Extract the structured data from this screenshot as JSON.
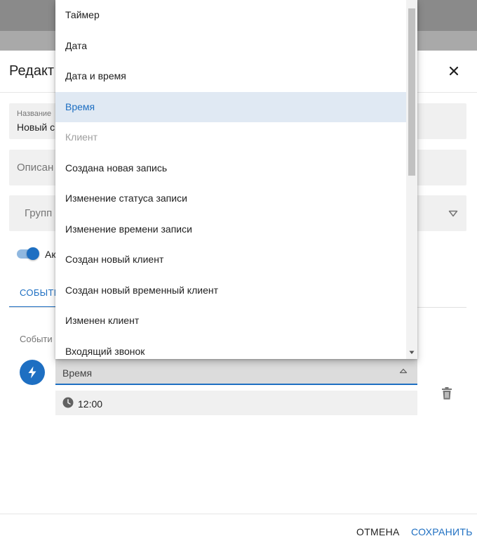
{
  "dialog": {
    "title": "Редакт",
    "name_field": {
      "label": "Название",
      "value": "Новый с"
    },
    "description_field": {
      "placeholder": "Описан"
    },
    "group_field": {
      "placeholder": "Групп"
    },
    "active_toggle": {
      "label": "Ак",
      "on": true
    },
    "tabs": [
      {
        "label": "СОБЫТИ",
        "active": true
      }
    ],
    "events_label": "Событи",
    "event": {
      "select_value": "Время",
      "time_value": "12:00"
    },
    "footer": {
      "cancel_label": "ОТМЕНА",
      "save_label": "СОХРАНИТЬ"
    }
  },
  "dropdown": {
    "items": [
      {
        "label": "Таймер",
        "state": "normal"
      },
      {
        "label": "Дата",
        "state": "normal"
      },
      {
        "label": "Дата и время",
        "state": "normal"
      },
      {
        "label": "Время",
        "state": "selected"
      },
      {
        "label": "Клиент",
        "state": "disabled"
      },
      {
        "label": "Создана новая запись",
        "state": "normal"
      },
      {
        "label": "Изменение статуса записи",
        "state": "normal"
      },
      {
        "label": "Изменение времени записи",
        "state": "normal"
      },
      {
        "label": "Создан новый клиент",
        "state": "normal"
      },
      {
        "label": "Создан новый временный клиент",
        "state": "normal"
      },
      {
        "label": "Изменен клиент",
        "state": "normal"
      },
      {
        "label": "Входящий звонок",
        "state": "normal"
      }
    ]
  },
  "colors": {
    "accent": "#1e6fc2",
    "selected_item_bg": "#e0e9f3",
    "field_bg": "#f0f0f0",
    "backdrop": "#8c8c8c"
  },
  "icons": [
    "close-icon",
    "dropdown-triangle-icon",
    "bolt-icon",
    "clock-icon",
    "trash-icon",
    "chevron-up-icon",
    "scroll-down-arrow-icon"
  ]
}
